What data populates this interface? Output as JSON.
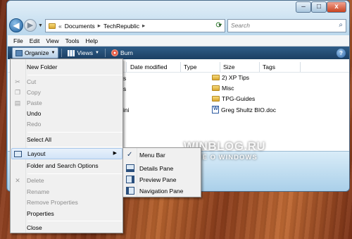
{
  "window": {
    "address_path": [
      "Documents",
      "TechRepublic"
    ],
    "search_placeholder": "Search",
    "controls": {
      "minimize": "–",
      "maximize": "□",
      "close": "x"
    }
  },
  "menubar": [
    "File",
    "Edit",
    "View",
    "Tools",
    "Help"
  ],
  "commandbar": {
    "organize": "Organize",
    "views": "Views",
    "burn": "Burn"
  },
  "columns": [
    "Date modified",
    "Type",
    "Size",
    "Tags"
  ],
  "files": [
    {
      "name": "2) XP Tips",
      "kind": "folder"
    },
    {
      "name": "Misc",
      "kind": "folder"
    },
    {
      "name": "TPG-Guides",
      "kind": "folder"
    },
    {
      "name": "Greg Shultz BIO.doc",
      "kind": "doc"
    }
  ],
  "left_fragments": [
    "s",
    "s",
    "ini"
  ],
  "organize_menu": [
    {
      "label": "New Folder",
      "disabled": false
    },
    {
      "label": "Cut",
      "disabled": true
    },
    {
      "label": "Copy",
      "disabled": true
    },
    {
      "label": "Paste",
      "disabled": true
    },
    {
      "label": "Undo",
      "disabled": false
    },
    {
      "label": "Redo",
      "disabled": true
    },
    {
      "label": "Select All",
      "disabled": false
    },
    {
      "label": "Layout",
      "disabled": false
    },
    {
      "label": "Folder and Search Options",
      "disabled": false
    },
    {
      "label": "Delete",
      "disabled": true
    },
    {
      "label": "Rename",
      "disabled": true
    },
    {
      "label": "Remove Properties",
      "disabled": true
    },
    {
      "label": "Properties",
      "disabled": false
    },
    {
      "label": "Close",
      "disabled": false
    }
  ],
  "layout_submenu": [
    {
      "label": "Menu Bar",
      "checked": true
    },
    {
      "label": "Details Pane",
      "checked": false
    },
    {
      "label": "Preview Pane",
      "checked": false
    },
    {
      "label": "Navigation Pane",
      "checked": false
    }
  ],
  "watermark": {
    "line1": "WINBLOG.RU",
    "line2": "ВСЁ О WINDOWS"
  }
}
